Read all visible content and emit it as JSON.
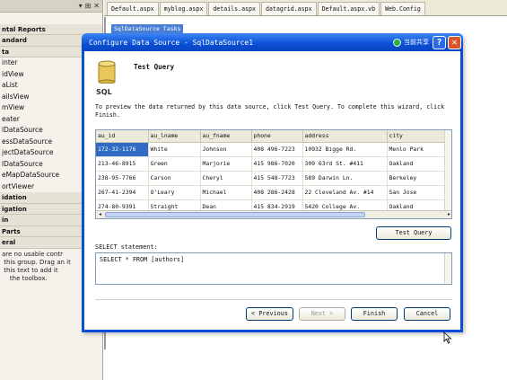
{
  "toolbox": {
    "header_buttons": [
      "▾",
      "⊞",
      "✕"
    ],
    "items": [
      {
        "label": "",
        "group": false
      },
      {
        "label": "ntal Reports",
        "group": true
      },
      {
        "label": "andard",
        "group": true
      },
      {
        "label": "ta",
        "group": true
      },
      {
        "label": "inter",
        "group": false
      },
      {
        "label": "idView",
        "group": false
      },
      {
        "label": "aList",
        "group": false
      },
      {
        "label": "ailsView",
        "group": false
      },
      {
        "label": "mView",
        "group": false
      },
      {
        "label": "eater",
        "group": false
      },
      {
        "label": "lDataSource",
        "group": false
      },
      {
        "label": "essDataSource",
        "group": false
      },
      {
        "label": "jectDataSource",
        "group": false
      },
      {
        "label": "lDataSource",
        "group": false
      },
      {
        "label": "eMapDataSource",
        "group": false
      },
      {
        "label": "ortViewer",
        "group": false
      },
      {
        "label": "idation",
        "group": true
      },
      {
        "label": "igation",
        "group": true
      },
      {
        "label": "in",
        "group": true
      },
      {
        "label": "Parts",
        "group": true
      },
      {
        "label": "eral",
        "group": true
      }
    ],
    "hint": "are no usable contr\n this group. Drag an it\n this text to add it\n    the toolbox."
  },
  "tabs": [
    "Default.aspx",
    "myblog.aspx",
    "details.aspx",
    "datagrid.aspx",
    "Default.aspx.vb",
    "Web.Config"
  ],
  "designer": {
    "smart_tag": "SqlDataSource Tasks"
  },
  "dialog": {
    "title": "Configure Data Source - SqlDataSource1",
    "ime_text": "当前共享",
    "help_glyph": "?",
    "close_glyph": "✕",
    "icon_label": "SQL",
    "step_title": "Test Query",
    "instructions": "To preview the data returned by this data source, click Test Query. To complete this wizard, click Finish.",
    "grid": {
      "columns": [
        "au_id",
        "au_lname",
        "au_fname",
        "phone",
        "address",
        "city"
      ],
      "rows": [
        [
          "172-32-1176",
          "White",
          "Johnson",
          "408 496-7223",
          "10932 Bigge Rd.",
          "Menlo Park"
        ],
        [
          "213-46-8915",
          "Green",
          "Marjorie",
          "415 986-7020",
          "309 63rd St. #411",
          "Oakland"
        ],
        [
          "238-95-7766",
          "Carson",
          "Cheryl",
          "415 548-7723",
          "589 Darwin Ln.",
          "Berkeley"
        ],
        [
          "267-41-2394",
          "O'Leary",
          "Michael",
          "408 286-2428",
          "22 Cleveland Av. #14",
          "San Jose"
        ],
        [
          "274-80-9391",
          "Straight",
          "Dean",
          "415 834-2919",
          "5420 College Av.",
          "Oakland"
        ]
      ]
    },
    "test_query_button": "Test Query",
    "select_label": "SELECT statement:",
    "select_statement": "SELECT * FROM [authors]",
    "buttons": {
      "previous": "< Previous",
      "next": "Next >",
      "finish": "Finish",
      "cancel": "Cancel"
    }
  },
  "colors": {
    "title_bar": "#0a4fd4",
    "selection": "#316ac5"
  }
}
